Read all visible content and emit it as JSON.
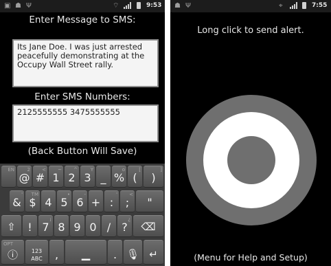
{
  "left_screen": {
    "status_bar": {
      "clock": "9:53",
      "icons": [
        "image-icon",
        "android-icon",
        "usb-icon",
        "wifi-icon",
        "signal-icon",
        "battery-icon"
      ]
    },
    "message_label": "Enter Message to SMS:",
    "message_value": "Its Jane Doe. I was just arrested peacefully demonstrating at the Occupy Wall Street rally.",
    "numbers_label": "Enter SMS Numbers:",
    "numbers_value": "2125555555 3475555555",
    "back_hint": "(Back Button Will Save)",
    "keyboard": {
      "row1": [
        {
          "main": "",
          "sub": "EN"
        },
        {
          "main": "@",
          "sub": "2"
        },
        {
          "main": "#",
          "sub": "<"
        },
        {
          "main": "1",
          "sub": "~"
        },
        {
          "main": "2",
          "sub": "^"
        },
        {
          "main": "3",
          "sub": "Y"
        },
        {
          "main": "_",
          "sub": ""
        },
        {
          "main": "%",
          "sub": "o"
        },
        {
          "main": "(",
          "sub": "["
        },
        {
          "main": ")",
          "sub": "]"
        }
      ],
      "row2": [
        {
          "main": "&",
          "sub": "'"
        },
        {
          "main": "$",
          "sub": "TM"
        },
        {
          "main": "4",
          "sub": ""
        },
        {
          "main": "5",
          "sub": "•"
        },
        {
          "main": "6",
          "sub": "-"
        },
        {
          "main": "+",
          "sub": ""
        },
        {
          "main": ":",
          "sub": "'"
        },
        {
          "main": ";",
          "sub": "<"
        },
        {
          "main": "\"",
          "sub": ""
        }
      ],
      "row3": [
        {
          "main": "!",
          "sub": ""
        },
        {
          "main": "7",
          "sub": "¡"
        },
        {
          "main": "8",
          "sub": ""
        },
        {
          "main": "9",
          "sub": ""
        },
        {
          "main": "0",
          "sub": ""
        },
        {
          "main": "/",
          "sub": ""
        },
        {
          "main": "?",
          "sub": "¿"
        }
      ],
      "opt_label": "OPT",
      "abc_top": "123",
      "abc_bottom": "ABC",
      "comma": ",",
      "period": "."
    }
  },
  "right_screen": {
    "status_bar": {
      "clock": "7:55",
      "icons": [
        "android-icon",
        "usb-icon",
        "gps-icon",
        "signal-icon",
        "battery-icon"
      ]
    },
    "title": "Long click to send alert.",
    "footer": "(Menu for Help and Setup)",
    "target": {
      "outer_color": "#6f6f6f",
      "middle_color": "#ffffff",
      "inner_color": "#6f6f6f"
    }
  }
}
